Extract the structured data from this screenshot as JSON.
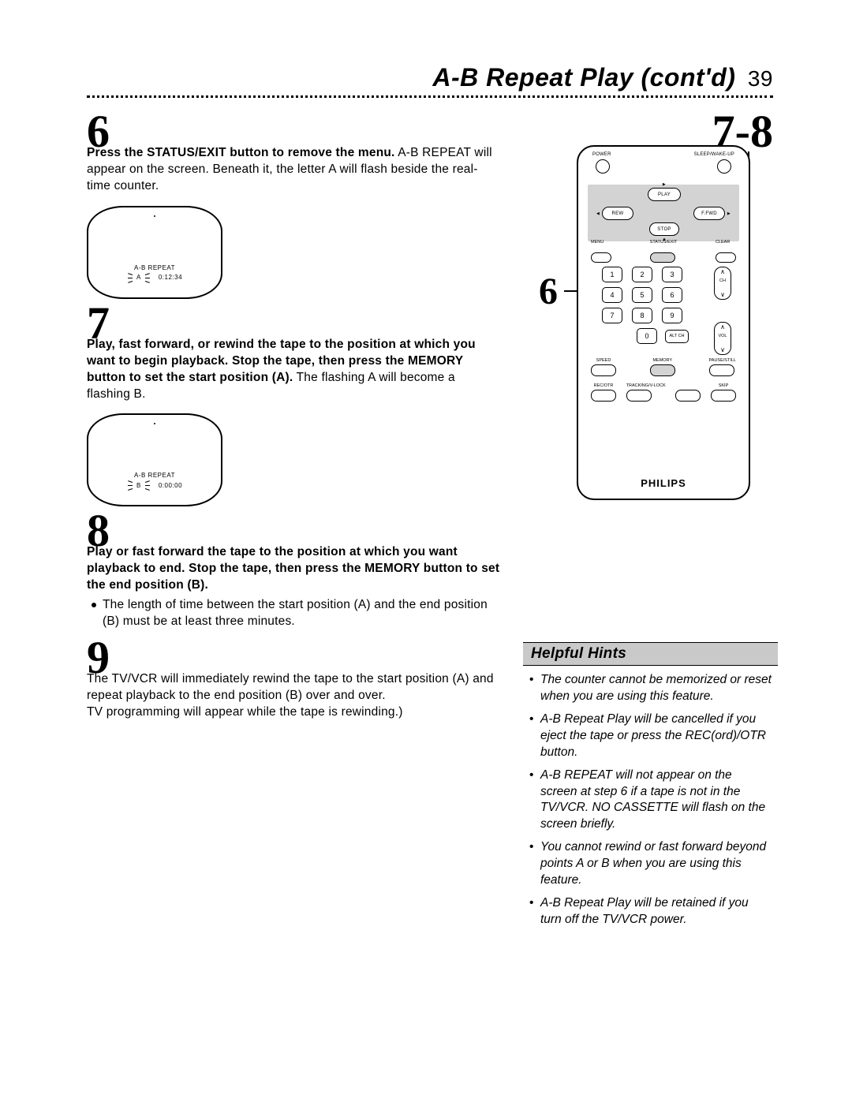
{
  "header": {
    "title": "A-B Repeat Play (cont'd)",
    "page_number": "39"
  },
  "steps": {
    "six": {
      "num": "6",
      "bold": "Press the STATUS/EXIT button to remove the menu.",
      "rest": " A-B REPEAT will appear on the screen. Beneath it, the letter A will flash beside the real-time counter."
    },
    "seven": {
      "num": "7",
      "bold": "Play, fast forward, or rewind the tape to the position at which you want to begin playback. Stop the tape, then press the MEMORY button to set the start position (A).",
      "rest": " The flashing A will become a flashing B."
    },
    "eight": {
      "num": "8",
      "bold": "Play or fast forward the tape to the position at which you want playback to end. Stop the tape, then press the MEMORY button to set the end position (B).",
      "bullet": "The length of time between the start position (A) and the end position (B) must be at least three minutes."
    },
    "nine": {
      "num": "9",
      "line1": "The TV/VCR will immediately rewind the tape to the start posi­tion (A) and repeat playback to the end position (B) over and over.",
      "line2": "TV programming will appear while the tape is rewinding.)"
    }
  },
  "tv1": {
    "label": "A-B REPEAT",
    "letter": "A",
    "counter": "0:12:34"
  },
  "tv2": {
    "label": "A-B REPEAT",
    "letter": "B",
    "counter": "0:00:00"
  },
  "remote": {
    "top_left": "POWER",
    "top_right": "SLEEP/WAKE-UP",
    "play": "PLAY",
    "rew": "REW",
    "ffwd": "F.FWD",
    "stop": "STOP",
    "menu": "MENU",
    "status": "STATUS/EXIT",
    "clear": "CLEAR",
    "numbers": [
      "1",
      "2",
      "3",
      "4",
      "5",
      "6",
      "7",
      "8",
      "9"
    ],
    "zero": "0",
    "altch": "ALT CH",
    "ch": "CH",
    "vol": "VOL",
    "speed": "SPEED",
    "memory": "MEMORY",
    "pause": "PAUSE/STILL",
    "recotr": "REC/OTR",
    "tracking": "TRACKING/V-LOCK",
    "skip": "SKIP",
    "brand": "PHILIPS"
  },
  "callouts": {
    "c6": "6",
    "c78": "7-8"
  },
  "hints": {
    "title": "Helpful Hints",
    "items": [
      "The counter cannot be memorized or reset when you are using this feature.",
      "A-B Repeat Play will be cancelled if you eject the tape or press the REC(ord)/OTR button.",
      "A-B REPEAT will not appear on the screen at step 6 if a tape is not in the TV/VCR. NO CASSETTE will flash on the screen briefly.",
      "You cannot rewind or fast forward beyond points A or B when you are using this feature.",
      "A-B Repeat Play will be retained if you turn off the TV/VCR power."
    ]
  }
}
